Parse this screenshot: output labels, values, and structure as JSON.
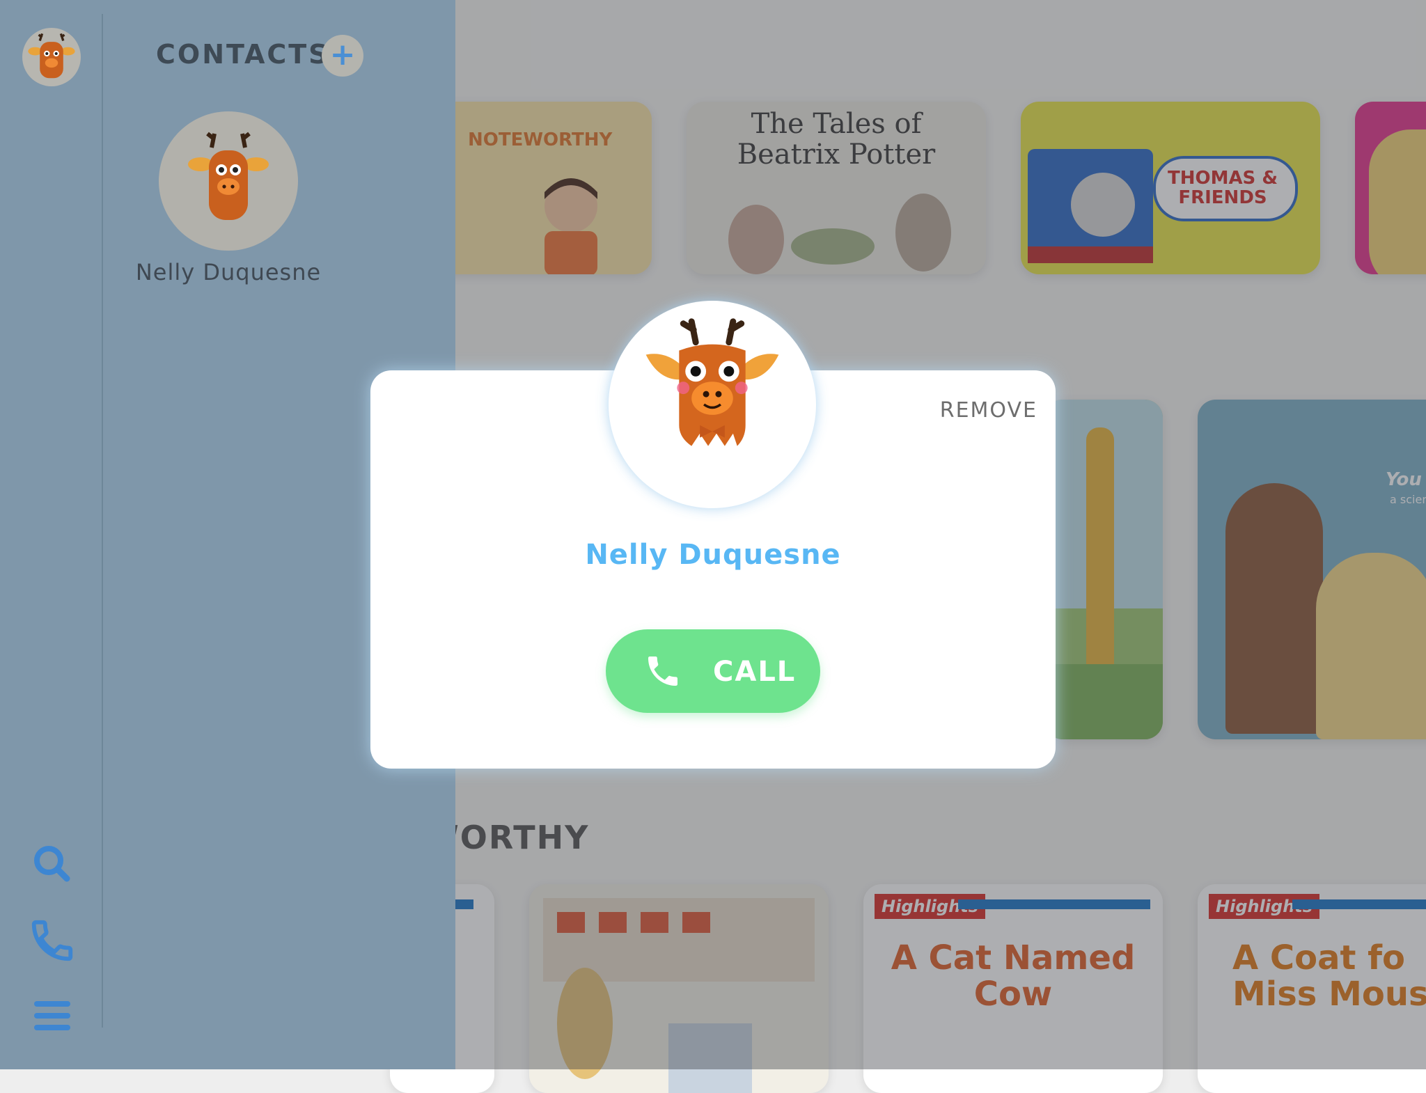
{
  "sidebar": {
    "title": "CONTACTS",
    "add_icon": "plus-icon",
    "add_label": "+",
    "contacts": [
      {
        "name": "Nelly Duquesne",
        "avatar": "reindeer-avatar"
      }
    ],
    "nav": [
      {
        "icon": "search-icon"
      },
      {
        "icon": "phone-icon"
      },
      {
        "icon": "menu-icon"
      }
    ]
  },
  "library": {
    "row1": [
      {
        "title_fragment": "NOTEWORTHY"
      },
      {
        "title": "The Tales of Beatrix Potter"
      },
      {
        "title": "THOMAS & FRIENDS"
      }
    ],
    "row2": [
      {
        "title_fragment": "You Ca"
      },
      {
        "title_fragment": "a scien"
      }
    ],
    "section_title_fragment": "WORTHY",
    "row3": [
      {
        "badge": "Highlights",
        "title": "A Cat Named Cow"
      },
      {
        "badge": "Highlights",
        "title": "A Coat fo Miss Mous"
      }
    ]
  },
  "modal": {
    "contact_name": "Nelly Duquesne",
    "remove_label": "REMOVE",
    "call_label": "CALL",
    "accent_color": "#58b7f4",
    "call_color": "#6ee38e"
  }
}
